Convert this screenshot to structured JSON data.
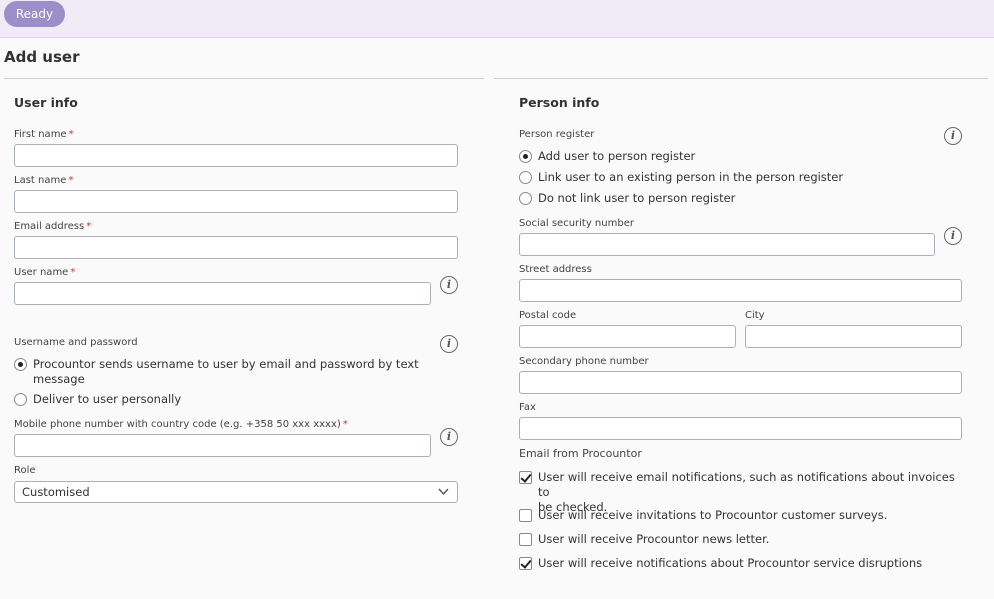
{
  "status": {
    "label": "Ready"
  },
  "page": {
    "title": "Add user"
  },
  "user_info": {
    "title": "User info",
    "first_name": {
      "label": "First name",
      "required": "*",
      "value": ""
    },
    "last_name": {
      "label": "Last name",
      "required": "*",
      "value": ""
    },
    "email": {
      "label": "Email address",
      "required": "*",
      "value": ""
    },
    "user_name": {
      "label": "User name",
      "required": "*",
      "value": ""
    },
    "credentials": {
      "label": "Username and password",
      "options": [
        {
          "label": "Procountor sends username to user by email and password by text message",
          "line1": "Procountor sends username to user by email and password by text",
          "line2": "message",
          "selected": true
        },
        {
          "label": "Deliver to user personally",
          "selected": false
        }
      ]
    },
    "mobile": {
      "label": "Mobile phone number with country code (e.g. +358 50 xxx xxxx)",
      "required": "*",
      "value": ""
    },
    "role": {
      "label": "Role",
      "value": "Customised"
    }
  },
  "person_info": {
    "title": "Person info",
    "register": {
      "label": "Person register",
      "options": [
        {
          "label": "Add user to person register",
          "selected": true
        },
        {
          "label": "Link user to an existing person in the person register",
          "selected": false
        },
        {
          "label": "Do not link user to person register",
          "selected": false
        }
      ]
    },
    "ssn": {
      "label": "Social security number",
      "value": ""
    },
    "street": {
      "label": "Street address",
      "value": ""
    },
    "postal_code": {
      "label": "Postal code",
      "value": ""
    },
    "city": {
      "label": "City",
      "value": ""
    },
    "secondary_phone": {
      "label": "Secondary phone number",
      "value": ""
    },
    "fax": {
      "label": "Fax",
      "value": ""
    },
    "email_prefs": {
      "label": "Email from Procountor",
      "options": [
        {
          "label": "User will receive email notifications, such as notifications about invoices to be checked.",
          "line1": "User will receive email notifications, such as notifications about invoices to",
          "line2": "be checked.",
          "checked": true
        },
        {
          "label": "User will receive invitations to Procountor customer surveys.",
          "checked": false
        },
        {
          "label": "User will receive Procountor news letter.",
          "checked": false
        },
        {
          "label": "User will receive notifications about Procountor service disruptions",
          "checked": true
        }
      ]
    }
  },
  "icons": {
    "info": "i"
  }
}
